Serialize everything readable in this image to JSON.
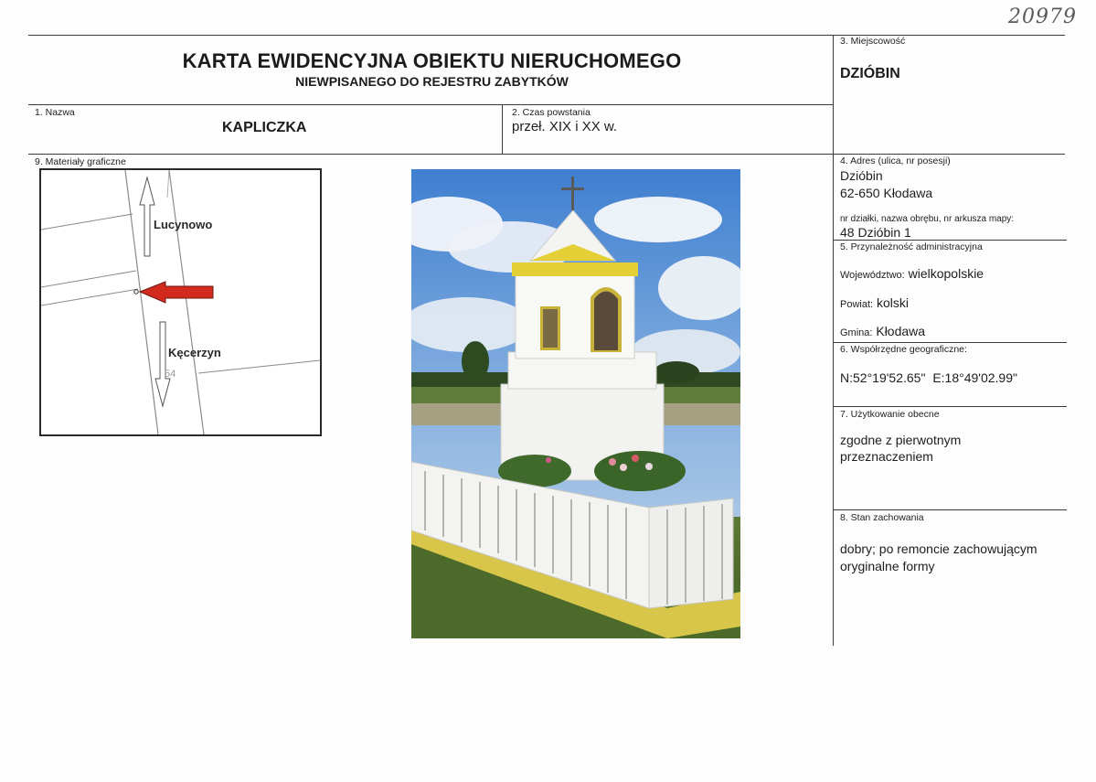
{
  "handwritten_number": "20979",
  "title": {
    "line1": "KARTA EWIDENCYJNA OBIEKTU NIERUCHOMEGO",
    "line2": "NIEWPISANEGO DO REJESTRU ZABYTKÓW"
  },
  "fields": {
    "nazwa": {
      "label": "1. Nazwa",
      "value": "KAPLICZKA"
    },
    "czas": {
      "label": "2. Czas powstania",
      "value": "przeł. XIX i XX w."
    },
    "miejscowosc": {
      "label": "3. Miejscowość",
      "value": "DZIÓBIN"
    },
    "adres": {
      "label": "4. Adres (ulica, nr posesji)",
      "line1": "Dzióbin",
      "line2": "62-650 Kłodawa",
      "dzialka_label": "nr działki, nazwa obrębu, nr arkusza mapy:",
      "dzialka_value": "48 Dzióbin 1"
    },
    "przynaleznosc": {
      "label": "5. Przynależność administracyjna",
      "wojewodztwo_label": "Województwo:",
      "wojewodztwo_value": "wielkopolskie",
      "powiat_label": "Powiat:",
      "powiat_value": "kolski",
      "gmina_label": "Gmina:",
      "gmina_value": "Kłodawa"
    },
    "wspolrzedne": {
      "label": "6. Współrzędne geograficzne:",
      "n": "N:52°19'52.65\"",
      "e": "E:18°49'02.99\""
    },
    "uzytkowanie": {
      "label": "7. Użytkowanie obecne",
      "line1": "zgodne z pierwotnym",
      "line2": "przeznaczeniem"
    },
    "stan": {
      "label": "8. Stan zachowania",
      "line1": "dobry; po remoncie zachowującym",
      "line2": "oryginalne formy"
    },
    "materialy": {
      "label": "9. Materiały graficzne"
    }
  },
  "map": {
    "label_north": "Lucynowo",
    "label_south": "Kęcerzyn",
    "parcel_number": "54",
    "arrow_color": "#d42a1e"
  }
}
